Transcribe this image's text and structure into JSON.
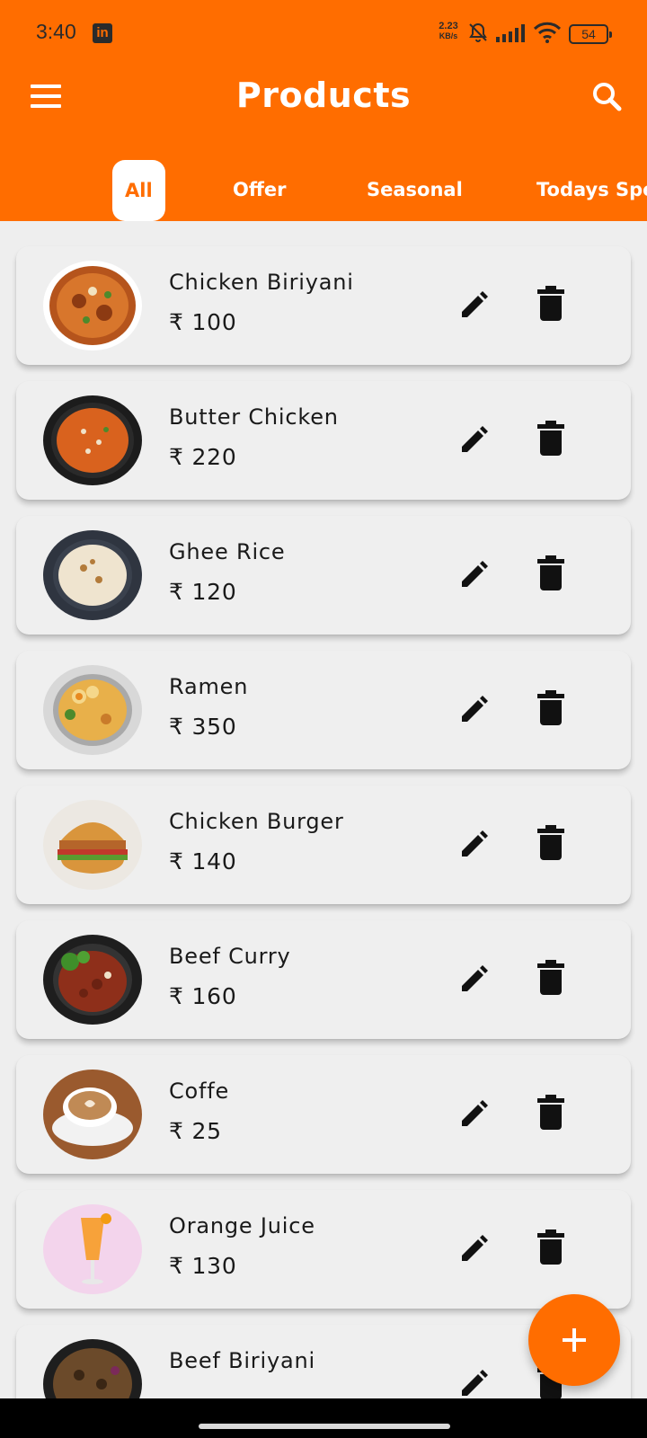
{
  "status_bar": {
    "time": "3:40",
    "net_speed_value": "2.23",
    "net_speed_unit": "KB/s",
    "battery": "54"
  },
  "header": {
    "title": "Products"
  },
  "tabs": [
    {
      "label": "All",
      "active": true
    },
    {
      "label": "Offer",
      "active": false
    },
    {
      "label": "Seasonal",
      "active": false
    },
    {
      "label": "Todays Spe",
      "active": false
    }
  ],
  "products": [
    {
      "name": "Chicken Biriyani",
      "price": "₹ 100",
      "image": "biriyani-photo"
    },
    {
      "name": "Butter Chicken",
      "price": "₹ 220",
      "image": "butter-chicken-photo"
    },
    {
      "name": "Ghee Rice",
      "price": "₹ 120",
      "image": "ghee-rice-photo"
    },
    {
      "name": "Ramen",
      "price": "₹ 350",
      "image": "ramen-photo"
    },
    {
      "name": "Chicken Burger",
      "price": "₹ 140",
      "image": "burger-photo"
    },
    {
      "name": "Beef Curry",
      "price": "₹ 160",
      "image": "beef-curry-photo"
    },
    {
      "name": "Coffe",
      "price": "₹ 25",
      "image": "coffee-photo"
    },
    {
      "name": "Orange Juice",
      "price": "₹ 130",
      "image": "orange-juice-photo"
    },
    {
      "name": "Beef Biriyani",
      "price": "",
      "image": "beef-biriyani-photo"
    }
  ],
  "colors": {
    "accent": "#ff6d00",
    "background": "#eeeeee",
    "card": "#efefef",
    "text": "#1a1a1a"
  },
  "icons": {
    "menu": "menu-icon",
    "search": "search-icon",
    "edit": "edit-icon",
    "delete": "delete-icon",
    "add": "plus-icon"
  }
}
